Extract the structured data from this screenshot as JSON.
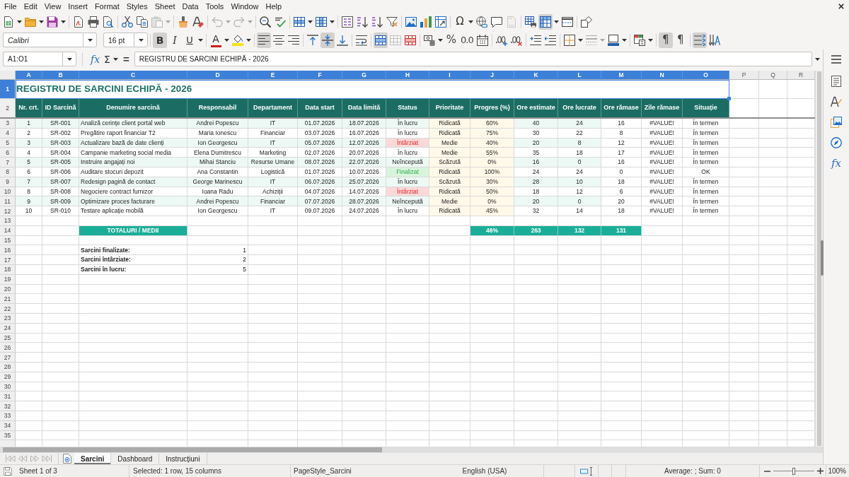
{
  "menu_bar": [
    "File",
    "Edit",
    "View",
    "Insert",
    "Format",
    "Styles",
    "Sheet",
    "Data",
    "Tools",
    "Window",
    "Help"
  ],
  "standard_toolbar": [
    [
      {
        "kind": "new",
        "pressed": false,
        "disabled": false
      },
      {
        "kind": "open",
        "pressed": false,
        "disabled": false
      },
      {
        "kind": "save",
        "pressed": false,
        "disabled": false
      }
    ],
    [
      {
        "kind": "export-pdf",
        "pressed": false,
        "disabled": false
      },
      {
        "kind": "print",
        "pressed": false,
        "disabled": false
      },
      {
        "kind": "print-preview",
        "pressed": false,
        "disabled": false
      }
    ],
    [
      {
        "kind": "cut",
        "pressed": false,
        "disabled": false
      },
      {
        "kind": "copy",
        "pressed": false,
        "disabled": false
      },
      {
        "kind": "paste",
        "pressed": false,
        "disabled": true
      }
    ],
    [
      {
        "kind": "clone",
        "pressed": false,
        "disabled": false
      },
      {
        "kind": "clear",
        "pressed": false,
        "disabled": false
      }
    ],
    [
      {
        "kind": "undo",
        "pressed": false,
        "disabled": true
      },
      {
        "kind": "redo",
        "pressed": false,
        "disabled": true
      }
    ],
    [
      {
        "kind": "find",
        "pressed": false,
        "disabled": false
      },
      {
        "kind": "spelling",
        "pressed": false,
        "disabled": false
      }
    ],
    [
      {
        "kind": "row",
        "pressed": false,
        "disabled": false
      },
      {
        "kind": "column",
        "pressed": false,
        "disabled": false
      }
    ],
    [
      {
        "kind": "sort",
        "pressed": false,
        "disabled": false
      },
      {
        "kind": "sort-ascending",
        "pressed": false,
        "disabled": false
      },
      {
        "kind": "sort-descending",
        "pressed": false,
        "disabled": false
      },
      {
        "kind": "autofilter",
        "pressed": false,
        "disabled": false
      }
    ],
    [
      {
        "kind": "image",
        "pressed": false,
        "disabled": false
      },
      {
        "kind": "chart",
        "pressed": false,
        "disabled": false
      },
      {
        "kind": "pivot-table",
        "pressed": false,
        "disabled": false
      }
    ],
    [
      {
        "kind": "special-character",
        "label": "Ω",
        "pressed": false,
        "disabled": false
      },
      {
        "kind": "hyperlink",
        "pressed": false,
        "disabled": false
      },
      {
        "kind": "comment",
        "pressed": false,
        "disabled": false
      },
      {
        "kind": "header-footer",
        "pressed": false,
        "disabled": true
      }
    ],
    [
      {
        "kind": "print-area",
        "pressed": false,
        "disabled": false
      },
      {
        "kind": "freeze",
        "pressed": true,
        "disabled": false
      },
      {
        "kind": "split",
        "pressed": false,
        "disabled": false
      }
    ],
    [
      {
        "kind": "shapes",
        "pressed": false,
        "disabled": false
      }
    ]
  ],
  "formatting_toolbar": {
    "font_name": "Calibri",
    "font_size": "16 pt",
    "groups": [
      [
        {
          "kind": "bold",
          "label": "B",
          "pressed": true,
          "disabled": false
        },
        {
          "kind": "italic",
          "label": "I",
          "pressed": false,
          "disabled": false
        },
        {
          "kind": "underline",
          "label": "U",
          "pressed": false,
          "disabled": false
        }
      ],
      [
        {
          "kind": "font-color",
          "label": "A",
          "pressed": false,
          "disabled": false
        },
        {
          "kind": "highlight",
          "pressed": false,
          "disabled": false
        }
      ],
      [
        {
          "kind": "align-left",
          "pressed": true,
          "disabled": false
        },
        {
          "kind": "align-center",
          "pressed": false,
          "disabled": false
        },
        {
          "kind": "align-right",
          "pressed": false,
          "disabled": false
        }
      ],
      [
        {
          "kind": "align-top",
          "pressed": false,
          "disabled": false
        },
        {
          "kind": "align-middle",
          "pressed": true,
          "disabled": false
        },
        {
          "kind": "align-bottom",
          "pressed": false,
          "disabled": false
        }
      ],
      [
        {
          "kind": "wrap-text",
          "pressed": false,
          "disabled": false
        }
      ],
      [
        {
          "kind": "merge-center",
          "pressed": true,
          "disabled": false
        },
        {
          "kind": "unmerge",
          "pressed": false,
          "disabled": true
        },
        {
          "kind": "merge-cells",
          "pressed": false,
          "disabled": false
        }
      ],
      [
        {
          "kind": "currency",
          "pressed": false,
          "disabled": false
        },
        {
          "kind": "percent",
          "label": "%",
          "pressed": false,
          "disabled": false
        },
        {
          "kind": "standard",
          "label": "0.0",
          "pressed": false,
          "disabled": false
        },
        {
          "kind": "date",
          "pressed": false,
          "disabled": false
        }
      ],
      [
        {
          "kind": "add-decimal",
          "pressed": false,
          "disabled": false
        },
        {
          "kind": "delete-decimal",
          "pressed": false,
          "disabled": false
        }
      ],
      [
        {
          "kind": "indent-increase",
          "pressed": false,
          "disabled": false
        },
        {
          "kind": "indent-decrease",
          "pressed": false,
          "disabled": false
        }
      ],
      [
        {
          "kind": "borders",
          "pressed": false,
          "disabled": false
        },
        {
          "kind": "border-style",
          "pressed": false,
          "disabled": true
        },
        {
          "kind": "border-color",
          "pressed": false,
          "disabled": false
        }
      ],
      [
        {
          "kind": "conditional",
          "pressed": false,
          "disabled": false
        }
      ],
      [
        {
          "kind": "ltr",
          "label": "¶",
          "pressed": true,
          "disabled": false
        },
        {
          "kind": "rtl",
          "label": "¶",
          "pressed": false,
          "disabled": false
        }
      ],
      [
        {
          "kind": "text-direction",
          "pressed": true,
          "disabled": false
        },
        {
          "kind": "vertical-text",
          "pressed": false,
          "disabled": false
        }
      ]
    ]
  },
  "formula_bar": {
    "name_box": "A1:O1",
    "function_wizard": "fx",
    "sum": "Σ",
    "equals": "=",
    "content": "REGISTRU DE SARCINI ECHIPĂ - 2026"
  },
  "sidebar": {
    "tabs": [
      {
        "kind": "properties",
        "selected": false
      },
      {
        "kind": "styles",
        "selected": false
      },
      {
        "kind": "gallery",
        "selected": false
      },
      {
        "kind": "navigator",
        "selected": false
      },
      {
        "kind": "functions",
        "label": "fx",
        "selected": false
      }
    ]
  },
  "sheet": {
    "columns": [
      {
        "label": "A",
        "selected": true
      },
      {
        "label": "B",
        "selected": true
      },
      {
        "label": "C",
        "selected": true
      },
      {
        "label": "D",
        "selected": true
      },
      {
        "label": "E",
        "selected": true
      },
      {
        "label": "F",
        "selected": true
      },
      {
        "label": "G",
        "selected": true
      },
      {
        "label": "H",
        "selected": true
      },
      {
        "label": "I",
        "selected": true
      },
      {
        "label": "J",
        "selected": true
      },
      {
        "label": "K",
        "selected": true
      },
      {
        "label": "L",
        "selected": true
      },
      {
        "label": "M",
        "selected": true
      },
      {
        "label": "N",
        "selected": true
      },
      {
        "label": "O",
        "selected": true
      },
      {
        "label": "P",
        "selected": false
      },
      {
        "label": "Q",
        "selected": false
      },
      {
        "label": "R",
        "selected": false
      }
    ],
    "rows": [
      {
        "kind": "title",
        "number": "1",
        "selected": true,
        "text": "REGISTRU DE SARCINI ECHIPĂ - 2026"
      },
      {
        "kind": "header",
        "number": "2",
        "selected": false,
        "cells": [
          "Nr. crt.",
          "ID Sarcină",
          "Denumire sarcină",
          "Responsabil",
          "Departament",
          "Data start",
          "Data limită",
          "Status",
          "Prioritate",
          "Progres (%)",
          "Ore estimate",
          "Ore lucrate",
          "Ore rămase",
          "Zile rămase",
          "Situație"
        ]
      },
      {
        "kind": "task",
        "number": "3",
        "selected": false,
        "overdue": false,
        "completed": false,
        "cells": [
          "1",
          "SR-001",
          "Analiză cerințe client portal web",
          "Andrei Popescu",
          "IT",
          "01.07.2026",
          "18.07.2026",
          "În lucru",
          "Ridicată",
          "60%",
          "40",
          "24",
          "16",
          "#VALUE!",
          "În termen"
        ]
      },
      {
        "kind": "task",
        "number": "4",
        "selected": false,
        "overdue": false,
        "completed": false,
        "cells": [
          "2",
          "SR-002",
          "Pregătire raport financiar T2",
          "Maria Ionescu",
          "Financiar",
          "03.07.2026",
          "16.07.2026",
          "În lucru",
          "Ridicată",
          "75%",
          "30",
          "22",
          "8",
          "#VALUE!",
          "În termen"
        ]
      },
      {
        "kind": "task",
        "number": "5",
        "selected": false,
        "overdue": true,
        "completed": false,
        "cells": [
          "3",
          "SR-003",
          "Actualizare bază de date clienți",
          "Ion Georgescu",
          "IT",
          "05.07.2026",
          "12.07.2026",
          "Întârziat",
          "Medie",
          "40%",
          "20",
          "8",
          "12",
          "#VALUE!",
          "În termen"
        ]
      },
      {
        "kind": "task",
        "number": "6",
        "selected": false,
        "overdue": false,
        "completed": false,
        "cells": [
          "4",
          "SR-004",
          "Campanie marketing social media",
          "Elena Dumitrescu",
          "Marketing",
          "02.07.2026",
          "20.07.2026",
          "În lucru",
          "Medie",
          "55%",
          "35",
          "18",
          "17",
          "#VALUE!",
          "În termen"
        ]
      },
      {
        "kind": "task",
        "number": "7",
        "selected": false,
        "overdue": false,
        "completed": false,
        "cells": [
          "5",
          "SR-005",
          "Instruire angajați noi",
          "Mihai Stanciu",
          "Resurse Umane",
          "08.07.2026",
          "22.07.2026",
          "Neîncepută",
          "Scăzută",
          "0%",
          "16",
          "0",
          "16",
          "#VALUE!",
          "În termen"
        ]
      },
      {
        "kind": "task",
        "number": "8",
        "selected": false,
        "overdue": false,
        "completed": true,
        "cells": [
          "6",
          "SR-006",
          "Auditare stocuri depozit",
          "Ana Constantin",
          "Logistică",
          "01.07.2026",
          "10.07.2026",
          "Finalizat",
          "Ridicată",
          "100%",
          "24",
          "24",
          "0",
          "#VALUE!",
          "OK"
        ]
      },
      {
        "kind": "task",
        "number": "9",
        "selected": false,
        "overdue": false,
        "completed": false,
        "cells": [
          "7",
          "SR-007",
          "Redesign pagină de contact",
          "George Marinescu",
          "IT",
          "06.07.2026",
          "25.07.2026",
          "În lucru",
          "Scăzută",
          "30%",
          "28",
          "10",
          "18",
          "#VALUE!",
          "În termen"
        ]
      },
      {
        "kind": "task",
        "number": "10",
        "selected": false,
        "overdue": true,
        "completed": false,
        "cells": [
          "8",
          "SR-008",
          "Negociere contract furnizor",
          "Ioana Radu",
          "Achiziții",
          "04.07.2026",
          "14.07.2026",
          "Întârziat",
          "Ridicată",
          "50%",
          "18",
          "12",
          "6",
          "#VALUE!",
          "În termen"
        ]
      },
      {
        "kind": "task",
        "number": "11",
        "selected": false,
        "overdue": false,
        "completed": false,
        "cells": [
          "9",
          "SR-009",
          "Optimizare proces facturare",
          "Andrei Popescu",
          "Financiar",
          "07.07.2026",
          "28.07.2026",
          "Neîncepută",
          "Medie",
          "0%",
          "20",
          "0",
          "20",
          "#VALUE!",
          "În termen"
        ]
      },
      {
        "kind": "task",
        "number": "12",
        "selected": false,
        "overdue": false,
        "completed": false,
        "cells": [
          "10",
          "SR-010",
          "Testare aplicație mobilă",
          "Ion Georgescu",
          "IT",
          "09.07.2026",
          "24.07.2026",
          "În lucru",
          "Ridicată",
          "45%",
          "32",
          "14",
          "18",
          "#VALUE!",
          "În termen"
        ]
      },
      {
        "kind": "blank",
        "number": "13",
        "selected": false
      },
      {
        "kind": "totals",
        "number": "14",
        "selected": false,
        "label": "TOTALURI / MEDII",
        "values": [
          "46%",
          "263",
          "132",
          "131"
        ]
      },
      {
        "kind": "blank",
        "number": "15",
        "selected": false
      },
      {
        "kind": "summary",
        "number": "16",
        "selected": false,
        "label": "Sarcini finalizate:",
        "value": "1"
      },
      {
        "kind": "summary",
        "number": "17",
        "selected": false,
        "label": "Sarcini întârziate:",
        "value": "2"
      },
      {
        "kind": "summary",
        "number": "18",
        "selected": false,
        "label": "Sarcini în lucru:",
        "value": "5"
      },
      {
        "kind": "blank",
        "number": "19",
        "selected": false
      },
      {
        "kind": "blank",
        "number": "20",
        "selected": false
      },
      {
        "kind": "blank",
        "number": "21",
        "selected": false
      },
      {
        "kind": "blank",
        "number": "22",
        "selected": false
      },
      {
        "kind": "blank",
        "number": "23",
        "selected": false
      },
      {
        "kind": "blank",
        "number": "24",
        "selected": false
      },
      {
        "kind": "blank",
        "number": "25",
        "selected": false
      },
      {
        "kind": "blank",
        "number": "26",
        "selected": false
      },
      {
        "kind": "blank",
        "number": "27",
        "selected": false
      },
      {
        "kind": "blank",
        "number": "28",
        "selected": false
      },
      {
        "kind": "blank",
        "number": "29",
        "selected": false
      },
      {
        "kind": "blank",
        "number": "30",
        "selected": false
      },
      {
        "kind": "blank",
        "number": "31",
        "selected": false
      },
      {
        "kind": "blank",
        "number": "32",
        "selected": false
      },
      {
        "kind": "blank",
        "number": "33",
        "selected": false
      },
      {
        "kind": "blank",
        "number": "34",
        "selected": false
      },
      {
        "kind": "blank",
        "number": "35",
        "selected": false
      }
    ]
  },
  "sheet_nav": [
    {
      "kind": "first",
      "disabled": true
    },
    {
      "kind": "previous",
      "disabled": true
    },
    {
      "kind": "next",
      "disabled": true
    },
    {
      "kind": "last",
      "disabled": true
    }
  ],
  "sheet_tabs": [
    {
      "label": "Sarcini",
      "selected": true
    },
    {
      "label": "Dashboard",
      "selected": false
    },
    {
      "label": "Instrucțiuni",
      "selected": false
    }
  ],
  "status_bar": {
    "sheet": "Sheet 1 of 3",
    "selection": "Selected: 1 row, 15 columns",
    "page_style": "PageStyle_Sarcini",
    "language": "English (USA)",
    "statistics": "Average: ; Sum: 0",
    "zoom": {
      "level": 0.5,
      "reading": "100%"
    }
  }
}
